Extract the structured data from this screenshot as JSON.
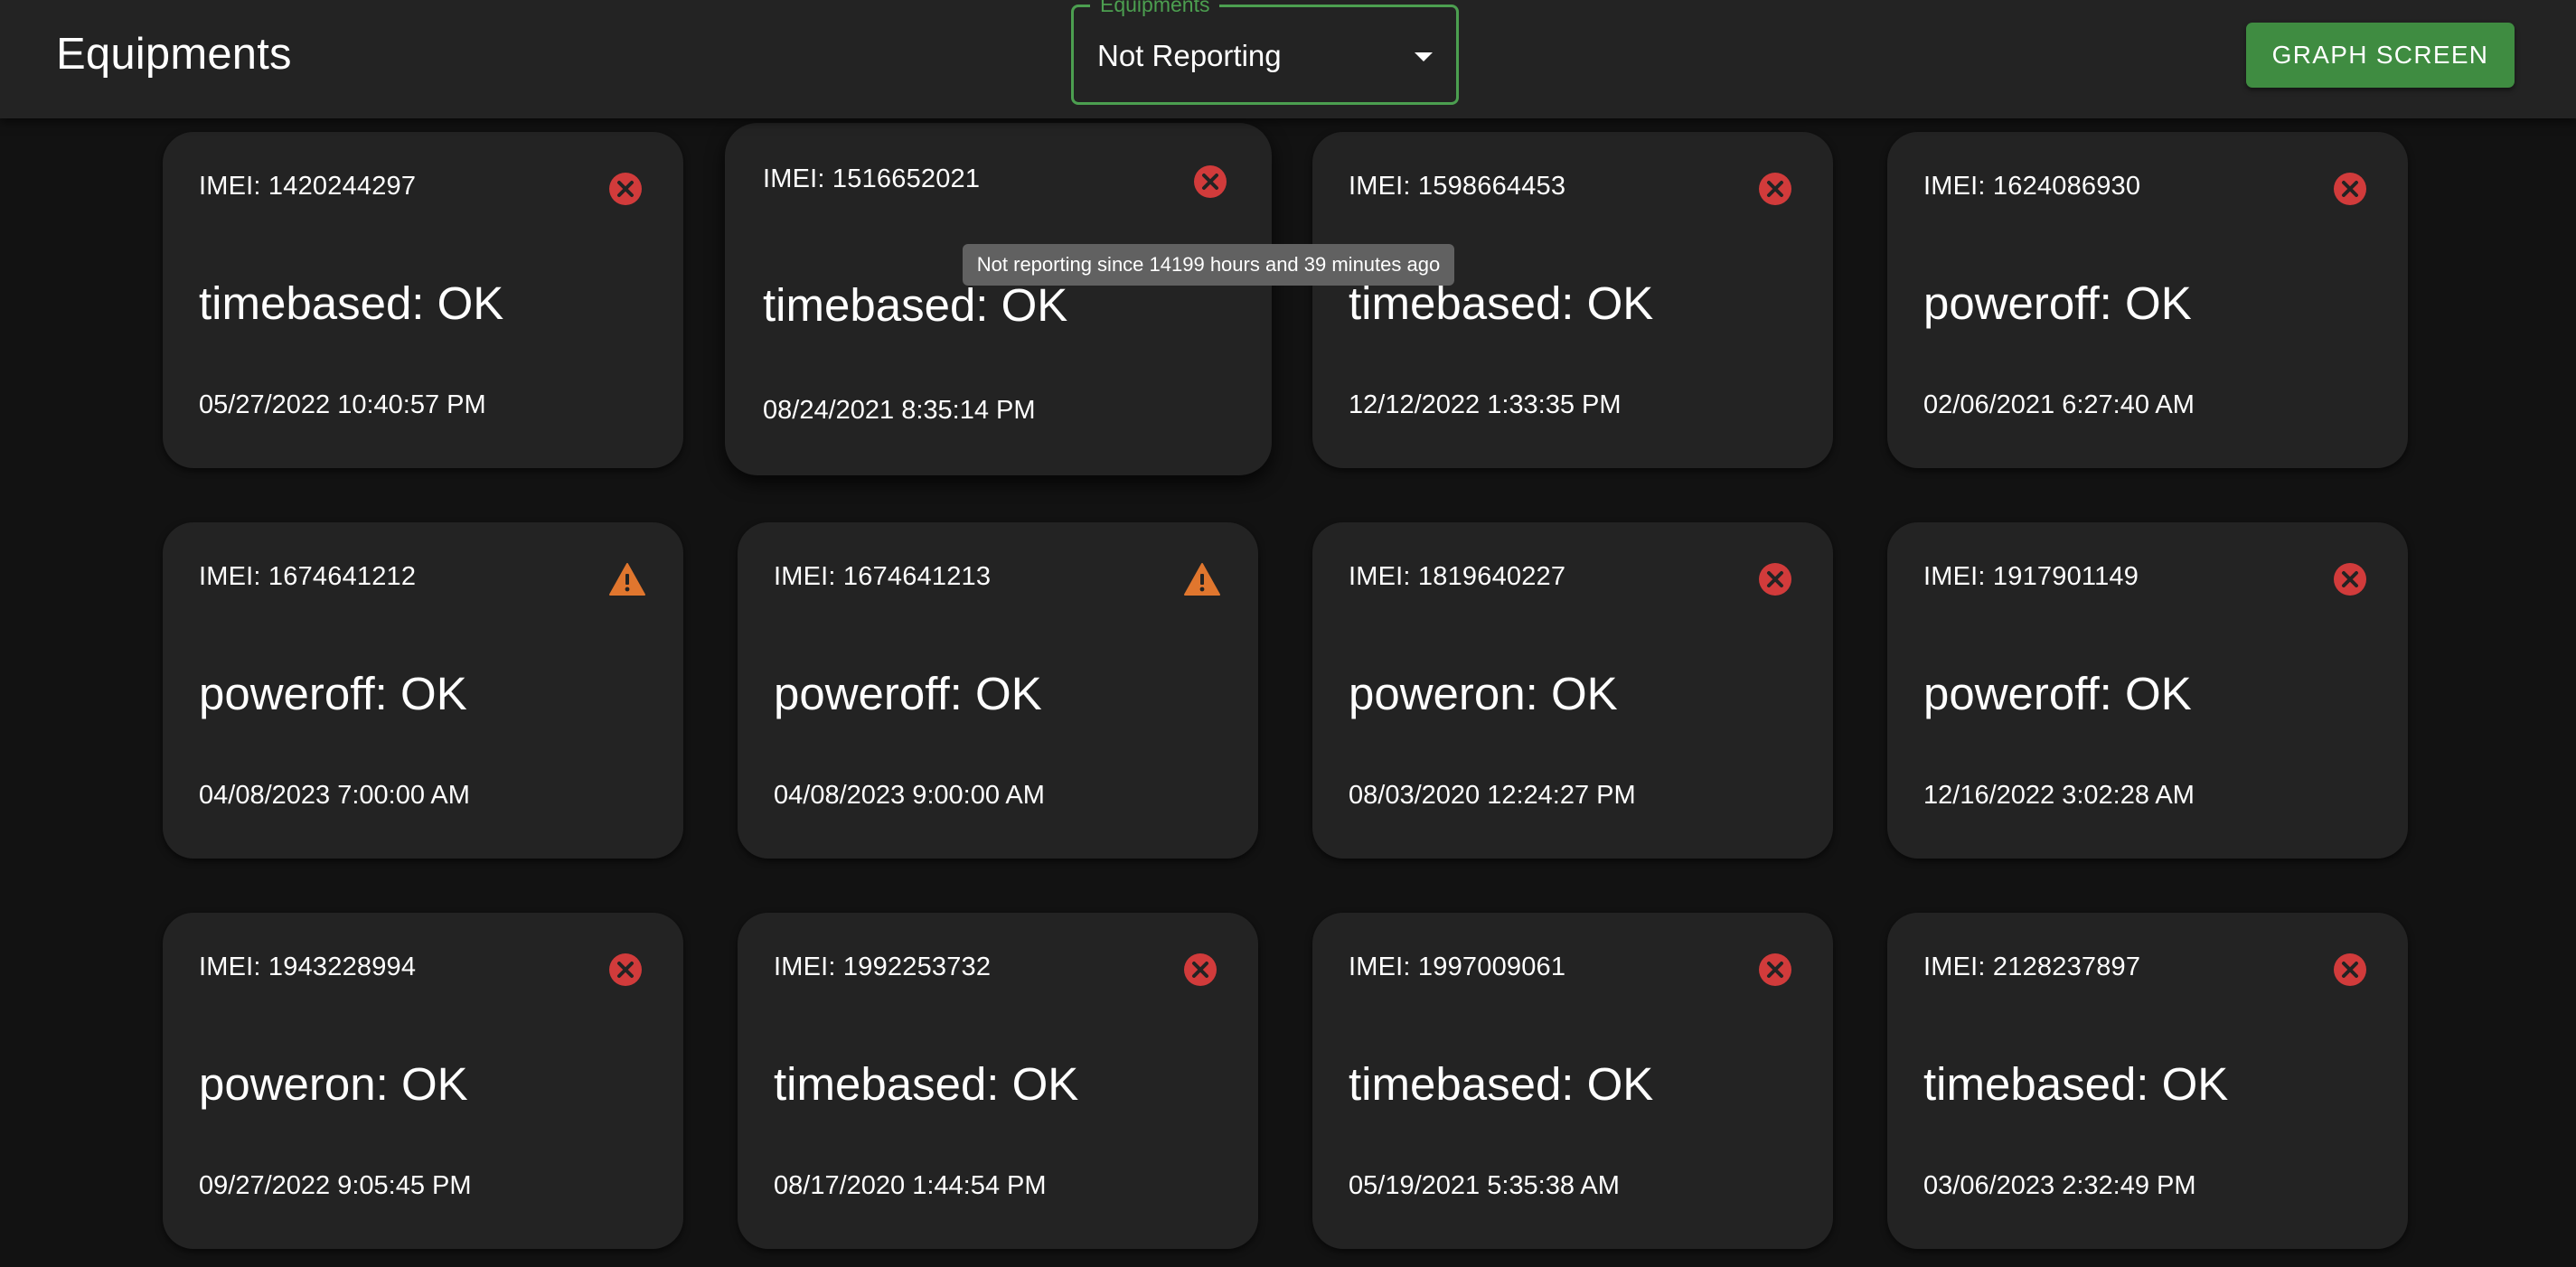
{
  "app_bar": {
    "title": "Equipments",
    "filter": {
      "label": "Equipments",
      "selected": "Not Reporting"
    },
    "graph_button_label": "GRAPH SCREEN"
  },
  "tooltip": {
    "text": "Not reporting since 14199 hours and 39 minutes ago"
  },
  "colors": {
    "error": "#d13b3b",
    "warning": "#e0762e",
    "accent": "#4c9f50",
    "card_bg": "#232323",
    "page_bg": "#121212"
  },
  "cards": [
    {
      "imei": "IMEI: 1420244297",
      "status": "timebased: OK",
      "timestamp": "05/27/2022 10:40:57 PM",
      "icon": "error-icon"
    },
    {
      "imei": "IMEI: 1516652021",
      "status": "timebased: OK",
      "timestamp": "08/24/2021 8:35:14 PM",
      "icon": "error-icon"
    },
    {
      "imei": "IMEI: 1598664453",
      "status": "timebased: OK",
      "timestamp": "12/12/2022 1:33:35 PM",
      "icon": "error-icon"
    },
    {
      "imei": "IMEI: 1624086930",
      "status": "poweroff: OK",
      "timestamp": "02/06/2021 6:27:40 AM",
      "icon": "error-icon"
    },
    {
      "imei": "IMEI: 1674641212",
      "status": "poweroff: OK",
      "timestamp": "04/08/2023 7:00:00 AM",
      "icon": "warning-icon"
    },
    {
      "imei": "IMEI: 1674641213",
      "status": "poweroff: OK",
      "timestamp": "04/08/2023 9:00:00 AM",
      "icon": "warning-icon"
    },
    {
      "imei": "IMEI: 1819640227",
      "status": "poweron: OK",
      "timestamp": "08/03/2020 12:24:27 PM",
      "icon": "error-icon"
    },
    {
      "imei": "IMEI: 1917901149",
      "status": "poweroff: OK",
      "timestamp": "12/16/2022 3:02:28 AM",
      "icon": "error-icon"
    },
    {
      "imei": "IMEI: 1943228994",
      "status": "poweron: OK",
      "timestamp": "09/27/2022 9:05:45 PM",
      "icon": "error-icon"
    },
    {
      "imei": "IMEI: 1992253732",
      "status": "timebased: OK",
      "timestamp": "08/17/2020 1:44:54 PM",
      "icon": "error-icon"
    },
    {
      "imei": "IMEI: 1997009061",
      "status": "timebased: OK",
      "timestamp": "05/19/2021 5:35:38 AM",
      "icon": "error-icon"
    },
    {
      "imei": "IMEI: 2128237897",
      "status": "timebased: OK",
      "timestamp": "03/06/2023 2:32:49 PM",
      "icon": "error-icon"
    }
  ]
}
